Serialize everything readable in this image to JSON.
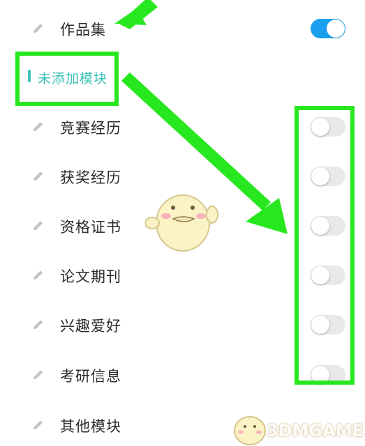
{
  "module_list": {
    "top_item": {
      "label": "作品集",
      "enabled": true
    },
    "section_title": "未添加模块",
    "items": [
      {
        "label": "竞赛经历",
        "enabled": false
      },
      {
        "label": "获奖经历",
        "enabled": false
      },
      {
        "label": "资格证书",
        "enabled": false
      },
      {
        "label": "论文期刊",
        "enabled": false
      },
      {
        "label": "兴趣爱好",
        "enabled": false
      },
      {
        "label": "考研信息",
        "enabled": false
      },
      {
        "label": "其他模块",
        "enabled": false
      }
    ]
  },
  "colors": {
    "accent": "#1aa0f0",
    "section_accent": "#3ac2b7",
    "annotation": "#27e81f"
  },
  "icons": {
    "edit": "pencil-icon"
  },
  "watermark": "3DMGAME"
}
